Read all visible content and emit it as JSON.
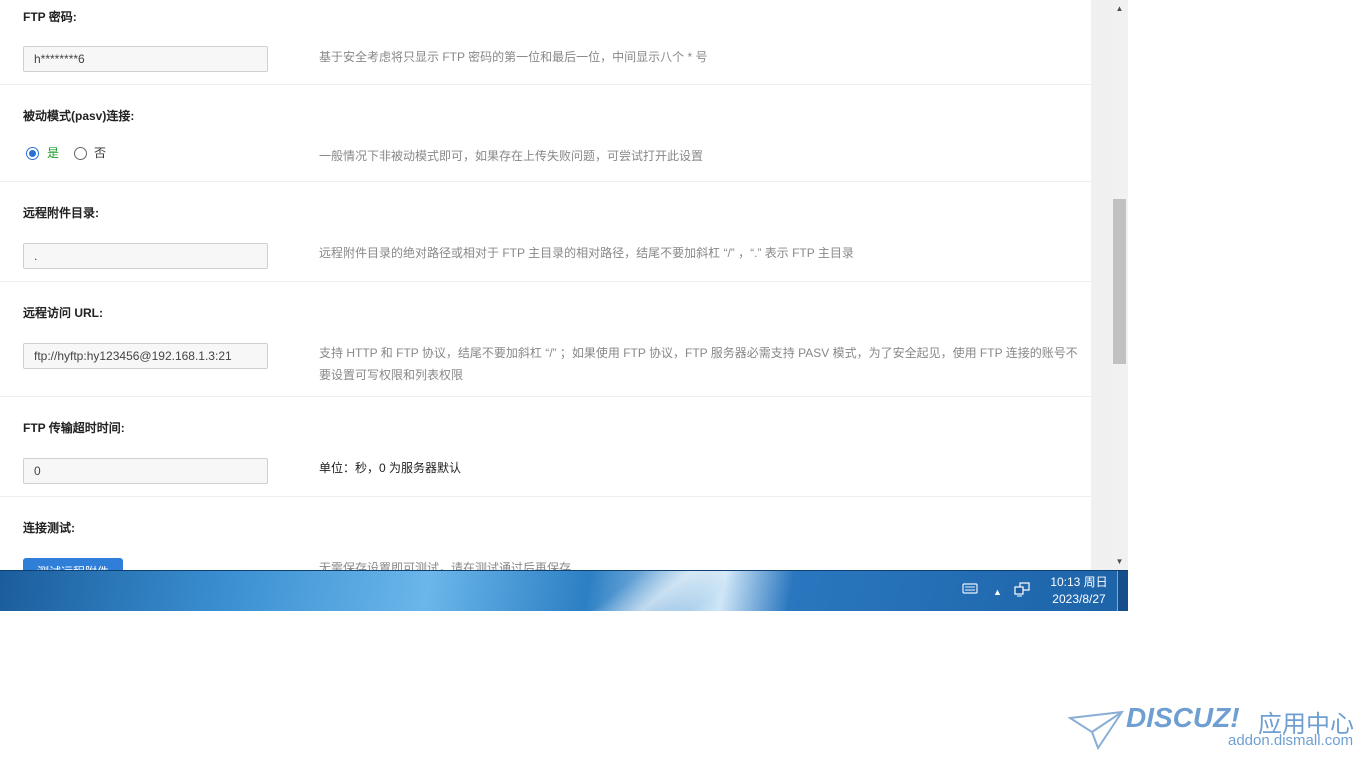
{
  "form": {
    "ftp_password": {
      "label": "FTP 密码:",
      "value": "h********6",
      "help": "基于安全考虑将只显示 FTP 密码的第一位和最后一位，中间显示八个 * 号"
    },
    "pasv": {
      "label": "被动模式(pasv)连接:",
      "option_yes": "是",
      "option_no": "否",
      "selected": "是",
      "help": "一般情况下非被动模式即可，如果存在上传失败问题，可尝试打开此设置"
    },
    "remote_dir": {
      "label": "远程附件目录:",
      "value": ".",
      "help": "远程附件目录的绝对路径或相对于 FTP 主目录的相对路径，结尾不要加斜杠 “/” ，“.” 表示 FTP 主目录"
    },
    "remote_url": {
      "label": "远程访问 URL:",
      "value": "ftp://hyftp:hy123456@192.168.1.3:21",
      "help": "支持 HTTP 和 FTP 协议，结尾不要加斜杠 “/” ；如果使用 FTP 协议，FTP 服务器必需支持 PASV 模式，为了安全起见，使用 FTP 连接的账号不要设置可写权限和列表权限"
    },
    "timeout": {
      "label": "FTP 传输超时时间:",
      "value": "0",
      "help": "单位：秒，0 为服务器默认"
    },
    "connection_test": {
      "label": "连接测试:",
      "button": "测试远程附件",
      "help": "无需保存设置即可测试，请在测试通过后再保存"
    }
  },
  "taskbar": {
    "time": "10:13 周日",
    "date": "2023/8/27",
    "tray_icons": [
      "keyboard-icon",
      "show-hidden-icons-arrow",
      "network-icon"
    ]
  },
  "watermark": {
    "brand": "DISCUZ!",
    "cn": "应用中心",
    "url": "addon.dismall.com"
  }
}
